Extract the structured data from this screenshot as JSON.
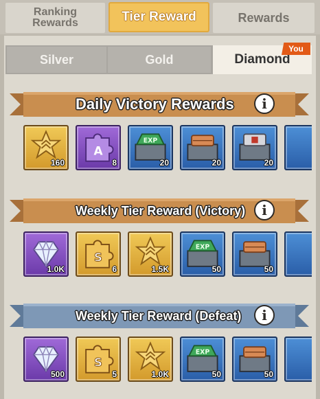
{
  "top_tabs": {
    "ranking_rewards": "Ranking\nRewards",
    "tier_reward": "Tier Reward",
    "rewards": "Rewards"
  },
  "tier_tabs": {
    "silver": "Silver",
    "gold": "Gold",
    "diamond": "Diamond",
    "you_badge": "You"
  },
  "sections": [
    {
      "title": "Daily Victory Rewards",
      "items": [
        {
          "icon": "badge-star-icon",
          "frame": "gold",
          "qty": "160"
        },
        {
          "icon": "puzzle-a-icon",
          "frame": "purple",
          "qty": "8"
        },
        {
          "icon": "exp-chest-icon",
          "frame": "blue",
          "qty": "20"
        },
        {
          "icon": "bronze-chest-icon",
          "frame": "blue",
          "qty": "20"
        },
        {
          "icon": "silver-chest-icon",
          "frame": "blue",
          "qty": "20"
        }
      ]
    },
    {
      "title": "Weekly Tier Reward (Victory)",
      "items": [
        {
          "icon": "diamond-icon",
          "frame": "purple",
          "qty": "1.0K"
        },
        {
          "icon": "puzzle-s-icon",
          "frame": "gold",
          "qty": "6"
        },
        {
          "icon": "badge-star-icon",
          "frame": "gold",
          "qty": "1.5K"
        },
        {
          "icon": "exp-chest-icon",
          "frame": "blue",
          "qty": "50"
        },
        {
          "icon": "bronze-chest-icon",
          "frame": "blue",
          "qty": "50"
        }
      ]
    },
    {
      "title": "Weekly Tier Reward (Defeat)",
      "items": [
        {
          "icon": "diamond-icon",
          "frame": "purple",
          "qty": "500"
        },
        {
          "icon": "puzzle-s-icon",
          "frame": "gold",
          "qty": "5"
        },
        {
          "icon": "badge-star-icon",
          "frame": "gold",
          "qty": "1.0K"
        },
        {
          "icon": "exp-chest-icon",
          "frame": "blue",
          "qty": "50"
        },
        {
          "icon": "bronze-chest-icon",
          "frame": "blue",
          "qty": "50"
        }
      ]
    }
  ],
  "colors": {
    "victory_banner": "#c0884b",
    "defeat_banner": "#7590b0",
    "tab_active": "#f2c35b",
    "you_badge": "#e25a17"
  }
}
